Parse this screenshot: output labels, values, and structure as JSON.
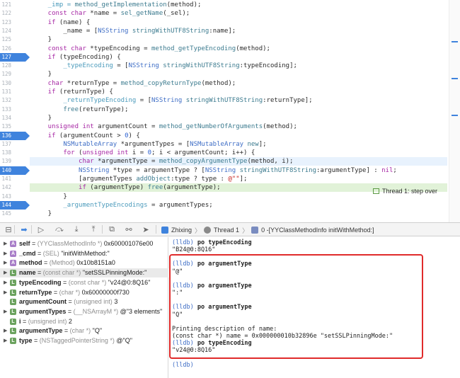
{
  "code": {
    "line_numbers": [
      "121",
      "122",
      "123",
      "124",
      "125",
      "126",
      "127",
      "128",
      "129",
      "130",
      "131",
      "132",
      "133",
      "134",
      "135",
      "136",
      "137",
      "138",
      "139",
      "140",
      "141",
      "142",
      "143",
      "144",
      "145"
    ],
    "breakpoint_lines": [
      "127",
      "136",
      "140",
      "144"
    ],
    "lines": [
      [
        {
          "t": "    _imp = ",
          "c": "v"
        },
        {
          "t": "method_getImplementation",
          "c": "f"
        },
        {
          "t": "(method);",
          "c": ""
        }
      ],
      [
        {
          "t": "    const char",
          "c": "k"
        },
        {
          "t": " *name = ",
          "c": ""
        },
        {
          "t": "sel_getName",
          "c": "f"
        },
        {
          "t": "(_sel);",
          "c": ""
        }
      ],
      [
        {
          "t": "    if",
          "c": "k"
        },
        {
          "t": " (name) {",
          "c": ""
        }
      ],
      [
        {
          "t": "        _name = [",
          "c": ""
        },
        {
          "t": "NSString",
          "c": "t"
        },
        {
          "t": " stringWithUTF8String",
          "c": "f"
        },
        {
          "t": ":name];",
          "c": ""
        }
      ],
      [
        {
          "t": "    }",
          "c": ""
        }
      ],
      [
        {
          "t": "    const char",
          "c": "k"
        },
        {
          "t": " *typeEncoding = ",
          "c": ""
        },
        {
          "t": "method_getTypeEncoding",
          "c": "f"
        },
        {
          "t": "(method);",
          "c": ""
        }
      ],
      [
        {
          "t": "    if",
          "c": "k"
        },
        {
          "t": " (typeEncoding) {",
          "c": ""
        }
      ],
      [
        {
          "t": "        _typeEncoding",
          "c": "v"
        },
        {
          "t": " = [",
          "c": ""
        },
        {
          "t": "NSString",
          "c": "t"
        },
        {
          "t": " stringWithUTF8String",
          "c": "f"
        },
        {
          "t": ":typeEncoding];",
          "c": ""
        }
      ],
      [
        {
          "t": "    }",
          "c": ""
        }
      ],
      [
        {
          "t": "    char",
          "c": "k"
        },
        {
          "t": " *returnType = ",
          "c": ""
        },
        {
          "t": "method_copyReturnType",
          "c": "f"
        },
        {
          "t": "(method);",
          "c": ""
        }
      ],
      [
        {
          "t": "    if",
          "c": "k"
        },
        {
          "t": " (returnType) {",
          "c": ""
        }
      ],
      [
        {
          "t": "        _returnTypeEncoding",
          "c": "v"
        },
        {
          "t": " = [",
          "c": ""
        },
        {
          "t": "NSString",
          "c": "t"
        },
        {
          "t": " stringWithUTF8String",
          "c": "f"
        },
        {
          "t": ":returnType];",
          "c": ""
        }
      ],
      [
        {
          "t": "        free",
          "c": "f"
        },
        {
          "t": "(returnType);",
          "c": ""
        }
      ],
      [
        {
          "t": "    }",
          "c": ""
        }
      ],
      [
        {
          "t": "    unsigned int",
          "c": "k"
        },
        {
          "t": " argumentCount = ",
          "c": ""
        },
        {
          "t": "method_getNumberOfArguments",
          "c": "f"
        },
        {
          "t": "(method);",
          "c": ""
        }
      ],
      [
        {
          "t": "    if",
          "c": "k"
        },
        {
          "t": " (argumentCount > ",
          "c": ""
        },
        {
          "t": "0",
          "c": "n"
        },
        {
          "t": ") {",
          "c": ""
        }
      ],
      [
        {
          "t": "        NSMutableArray",
          "c": "t"
        },
        {
          "t": " *argumentTypes = [",
          "c": ""
        },
        {
          "t": "NSMutableArray",
          "c": "t"
        },
        {
          "t": " new",
          "c": "f"
        },
        {
          "t": "];",
          "c": ""
        }
      ],
      [
        {
          "t": "        for",
          "c": "k"
        },
        {
          "t": " (",
          "c": ""
        },
        {
          "t": "unsigned int",
          "c": "k"
        },
        {
          "t": " i = ",
          "c": ""
        },
        {
          "t": "0",
          "c": "n"
        },
        {
          "t": "; i < argumentCount; i++) {",
          "c": ""
        }
      ],
      [
        {
          "t": "            char",
          "c": "k"
        },
        {
          "t": " *argumentType = ",
          "c": ""
        },
        {
          "t": "method_copyArgumentType",
          "c": "f"
        },
        {
          "t": "(method, i);",
          "c": ""
        }
      ],
      [
        {
          "t": "            NSString",
          "c": "t"
        },
        {
          "t": " *type = argumentType ? [",
          "c": ""
        },
        {
          "t": "NSString",
          "c": "t"
        },
        {
          "t": " stringWithUTF8String",
          "c": "f"
        },
        {
          "t": ":argumentType] : ",
          "c": ""
        },
        {
          "t": "nil",
          "c": "k"
        },
        {
          "t": ";",
          "c": ""
        }
      ],
      [
        {
          "t": "            [argumentTypes ",
          "c": ""
        },
        {
          "t": "addObject",
          "c": "f"
        },
        {
          "t": ":type ? type : ",
          "c": ""
        },
        {
          "t": "@\"\"",
          "c": "s"
        },
        {
          "t": "];",
          "c": ""
        }
      ],
      [
        {
          "t": "            if",
          "c": "k"
        },
        {
          "t": " (argumentType) ",
          "c": ""
        },
        {
          "t": "free",
          "c": "f"
        },
        {
          "t": "(argumentType);",
          "c": ""
        }
      ],
      [
        {
          "t": "        }",
          "c": ""
        }
      ],
      [
        {
          "t": "        _argumentTypeEncodings",
          "c": "v"
        },
        {
          "t": " = argumentTypes;",
          "c": ""
        }
      ],
      [
        {
          "t": "    }",
          "c": ""
        }
      ]
    ]
  },
  "pc_badge": "Thread 1: step over",
  "debug_bar": {
    "icons": [
      "hide-panel-icon",
      "breakpoints-toggle-icon",
      "continue-icon",
      "step-over-icon",
      "step-into-icon",
      "step-out-icon",
      "view-hierarchy-icon",
      "memory-graph-icon",
      "simulate-location-icon"
    ],
    "crumb_app": "Zhixing",
    "crumb_thread": "Thread 1",
    "crumb_frame": "0 -[YYClassMethodInfo initWithMethod:]"
  },
  "variables": [
    {
      "tri": "▶",
      "badge": "A",
      "name": "self",
      "type": "(YYClassMethodInfo *)",
      "value": "0x600001076e00"
    },
    {
      "tri": "▶",
      "badge": "A",
      "name": "_cmd",
      "type": "(SEL)",
      "value": "\"initWithMethod:\""
    },
    {
      "tri": "▶",
      "badge": "A",
      "name": "method",
      "type": "(Method)",
      "value": "0x10b8151a0"
    },
    {
      "tri": "▶",
      "badge": "L",
      "name": "name",
      "type": "(const char *)",
      "value": "\"setSSLPinningMode:\""
    },
    {
      "tri": "▶",
      "badge": "L",
      "name": "typeEncoding",
      "type": "(const char *)",
      "value": "\"v24@0:8Q16\""
    },
    {
      "tri": "▶",
      "badge": "L",
      "name": "returnType",
      "type": "(char *)",
      "value": "0x60000000f730"
    },
    {
      "tri": "",
      "badge": "L",
      "name": "argumentCount",
      "type": "(unsigned int)",
      "value": "3"
    },
    {
      "tri": "▶",
      "badge": "L",
      "name": "argumentTypes",
      "type": "(__NSArrayM *)",
      "value": "@\"3 elements\""
    },
    {
      "tri": "",
      "badge": "L",
      "name": "i",
      "type": "(unsigned int)",
      "value": "2"
    },
    {
      "tri": "▶",
      "badge": "L",
      "name": "argumentType",
      "type": "(char *)",
      "value": "\"Q\""
    },
    {
      "tri": "▶",
      "badge": "L",
      "name": "type",
      "type": "(NSTaggedPointerString *)",
      "value": "@\"Q\""
    }
  ],
  "console": [
    {
      "prompt": "(lldb)",
      "cmd": "po typeEncoding",
      "out": ""
    },
    {
      "prompt": "",
      "cmd": "",
      "out": "\"B24@0:8Q16\""
    },
    {
      "prompt": "",
      "cmd": "",
      "out": ""
    },
    {
      "prompt": "(lldb)",
      "cmd": "po argumentType",
      "out": ""
    },
    {
      "prompt": "",
      "cmd": "",
      "out": "\"@\""
    },
    {
      "prompt": "",
      "cmd": "",
      "out": ""
    },
    {
      "prompt": "(lldb)",
      "cmd": "po argumentType",
      "out": ""
    },
    {
      "prompt": "",
      "cmd": "",
      "out": "\":\""
    },
    {
      "prompt": "",
      "cmd": "",
      "out": ""
    },
    {
      "prompt": "(lldb)",
      "cmd": "po argumentType",
      "out": ""
    },
    {
      "prompt": "",
      "cmd": "",
      "out": "\"Q\""
    },
    {
      "prompt": "",
      "cmd": "",
      "out": ""
    },
    {
      "prompt": "",
      "cmd": "",
      "out": "Printing description of name:"
    },
    {
      "prompt": "",
      "cmd": "",
      "out": "(const char *) name = 0x000000010b32896e \"setSSLPinningMode:\""
    },
    {
      "prompt": "(lldb)",
      "cmd": "po typeEncoding",
      "out": ""
    },
    {
      "prompt": "",
      "cmd": "",
      "out": "\"v24@0:8Q16\""
    },
    {
      "prompt": "",
      "cmd": "",
      "out": ""
    },
    {
      "prompt": "(lldb)",
      "cmd": "",
      "out": ""
    }
  ],
  "colors": {
    "breakpoint": "#3f83dd",
    "pc_line": "#e1f2d8",
    "highlight_box": "#e02b2b"
  }
}
